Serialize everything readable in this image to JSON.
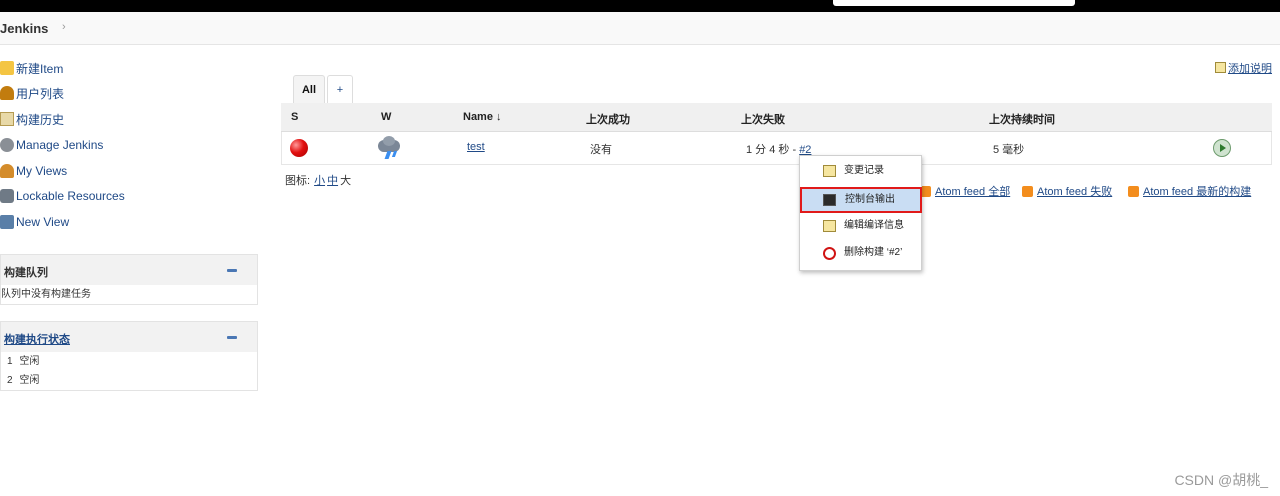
{
  "breadcrumb": {
    "home": "Jenkins",
    "separator": "›"
  },
  "sidebar": {
    "tasks": [
      {
        "label": "新建Item",
        "icon": "new-item-icon"
      },
      {
        "label": "用户列表",
        "icon": "people-icon"
      },
      {
        "label": "构建历史",
        "icon": "build-history-icon"
      },
      {
        "label": "Manage Jenkins",
        "icon": "gear-icon"
      },
      {
        "label": "My Views",
        "icon": "user-icon"
      },
      {
        "label": "Lockable Resources",
        "icon": "lock-icon"
      },
      {
        "label": "New View",
        "icon": "folder-icon"
      }
    ],
    "build_queue": {
      "title": "构建队列",
      "empty_text": "队列中没有构建任务"
    },
    "executors": {
      "title": "构建执行状态",
      "items": [
        {
          "num": "1",
          "status": "空闲"
        },
        {
          "num": "2",
          "status": "空闲"
        }
      ]
    }
  },
  "main": {
    "add_description": "添加说明",
    "tabs": [
      {
        "label": "All",
        "active": true
      },
      {
        "label": "+"
      }
    ],
    "table": {
      "columns": [
        "S",
        "W",
        "Name ↓",
        "上次成功",
        "上次失败",
        "上次持续时间"
      ],
      "rows": [
        {
          "status": "red",
          "weather": "storm",
          "name": "test",
          "last_success": "没有",
          "last_failure": "1 分 4 秒 - ",
          "last_failure_build": "#2",
          "last_duration": "5 毫秒"
        }
      ]
    },
    "legend": {
      "label": "图标:",
      "small": "小",
      "medium": "中",
      "large": "大"
    },
    "feeds": [
      "Atom feed 全部",
      "Atom feed 失败",
      "Atom feed 最新的构建"
    ]
  },
  "context_menu": {
    "items": [
      {
        "label": "变更记录",
        "icon": "notepad-icon"
      },
      {
        "label": "控制台输出",
        "icon": "terminal-icon",
        "highlighted": true
      },
      {
        "label": "编辑编译信息",
        "icon": "edit-icon"
      },
      {
        "label": "删除构建 ‘#2’",
        "icon": "delete-icon"
      }
    ]
  },
  "watermark": "CSDN @胡桃_",
  "colors": {
    "link": "#204a87",
    "highlight_border": "#e11a1a",
    "highlight_bg": "#c9ddf3",
    "status_red": "#e21010"
  }
}
